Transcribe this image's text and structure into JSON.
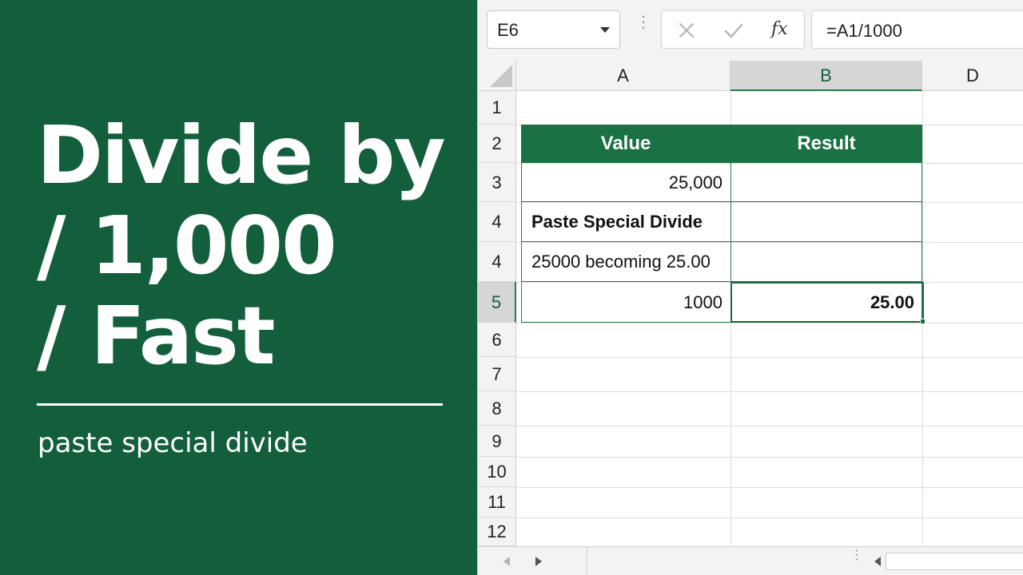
{
  "promo": {
    "headline_lines": [
      "Divide by",
      "/ 1,000",
      "/ Fast"
    ],
    "subtitle": "paste special divide",
    "background": "#135f3c"
  },
  "toolbar": {
    "name_box": "E6",
    "formula": "=A1/1000",
    "cancel_icon": "x-icon",
    "enter_icon": "check-icon",
    "fx_label": "fx"
  },
  "columns": [
    "A",
    "B",
    "D"
  ],
  "active_column": "B",
  "row_headers": [
    "1",
    "2",
    "3",
    "4",
    "4",
    "5",
    "6",
    "7",
    "8",
    "9",
    "10",
    "11",
    "12"
  ],
  "active_row": "5",
  "table": {
    "header_value": "Value",
    "header_result": "Result",
    "rows": [
      {
        "a": "25,000",
        "b": ""
      },
      {
        "a": "Paste Special Divide",
        "b": ""
      },
      {
        "a": "25000 becoming 25.00",
        "b": ""
      },
      {
        "a": "1000",
        "b": "25.00"
      }
    ]
  },
  "colors": {
    "accent": "#1a7143",
    "header_fill": "#1a7143"
  }
}
